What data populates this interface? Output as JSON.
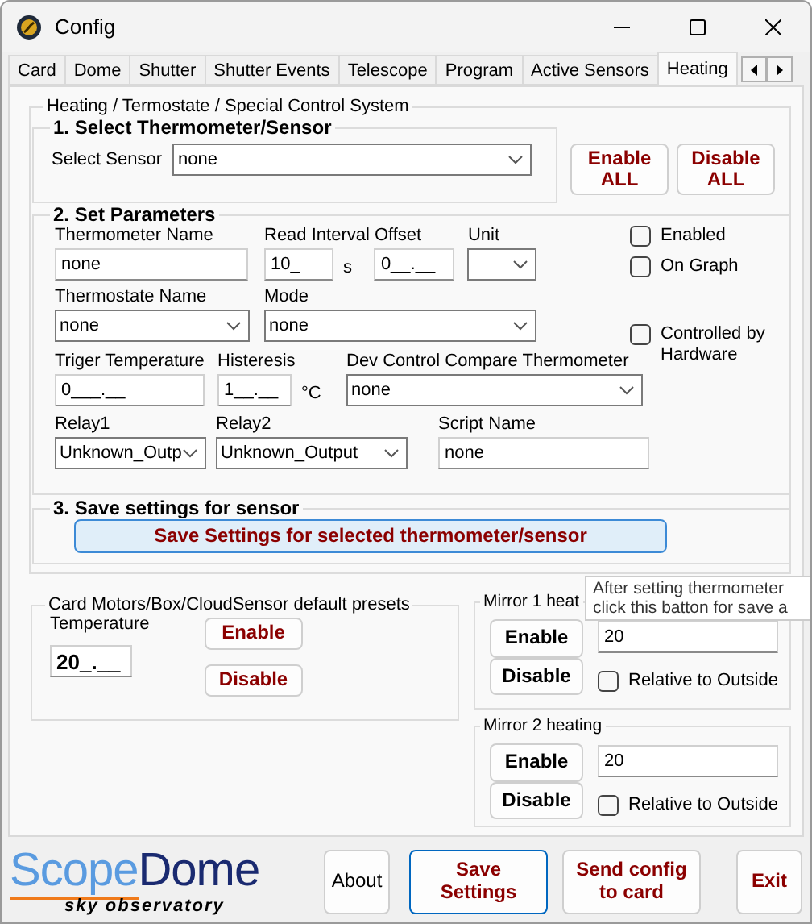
{
  "window": {
    "title": "Config"
  },
  "tabs": [
    {
      "label": "Card",
      "selected": false
    },
    {
      "label": "Dome",
      "selected": false
    },
    {
      "label": "Shutter",
      "selected": false
    },
    {
      "label": "Shutter Events",
      "selected": false
    },
    {
      "label": "Telescope",
      "selected": false
    },
    {
      "label": "Program",
      "selected": false
    },
    {
      "label": "Active Sensors",
      "selected": false
    },
    {
      "label": "Heating",
      "selected": true
    }
  ],
  "heating": {
    "title": "Heating / Termostate / Special Control System",
    "select_sensor": {
      "title": "1. Select Thermometer/Sensor",
      "label": "Select Sensor",
      "value": "none"
    },
    "bulk_buttons": [
      "Enable ALL",
      "Disable ALL"
    ],
    "parameters": {
      "title": "2. Set Parameters",
      "rows": [
        [
          {
            "label": "Thermometer Name",
            "kind": "input",
            "value": "none"
          },
          {
            "label": "Read Interval",
            "kind": "input",
            "value": "10_",
            "suffix": "s"
          },
          {
            "label": "Offset",
            "kind": "input",
            "value": "0__.__"
          },
          {
            "label": "Unit",
            "kind": "select"
          }
        ],
        [
          {
            "label": "Thermostate Name",
            "kind": "select",
            "value": "none"
          },
          {
            "label": "Mode",
            "kind": "select",
            "value": "none"
          }
        ],
        [
          {
            "label": "Triger Temperature",
            "kind": "input",
            "value": "0___.__"
          },
          {
            "label": "Histeresis",
            "kind": "input",
            "value": "1__.__",
            "suffix": "°C"
          },
          {
            "label": "Dev Control Compare Thermometer",
            "kind": "select",
            "value": "none"
          }
        ],
        [
          {
            "label": "Relay1",
            "kind": "select",
            "value": "Unknown_Outp"
          },
          {
            "label": "Relay2",
            "kind": "select",
            "value": "Unknown_Output"
          },
          {
            "label": "Script Name",
            "kind": "input",
            "value": "none"
          }
        ]
      ],
      "checkboxes": [
        {
          "label": "Enabled",
          "checked": false
        },
        {
          "label": "On Graph",
          "checked": false
        },
        {
          "label": "Controlled by Hardware",
          "checked": false
        }
      ]
    },
    "save": {
      "title": "3. Save settings for sensor",
      "button": "Save Settings for selected thermometer/sensor"
    }
  },
  "presets": {
    "title": "Card Motors/Box/CloudSensor default presets",
    "temperature_label": "Temperature",
    "temperature_value": "20_.__",
    "buttons": [
      "Enable",
      "Disable"
    ]
  },
  "mirrors": [
    {
      "title": "Mirror 1 heat",
      "buttons": [
        "Enable",
        "Disable"
      ],
      "value": "20",
      "relative": {
        "label": "Relative to Outside",
        "checked": false
      }
    },
    {
      "title": "Mirror 2 heating",
      "buttons": [
        "Enable",
        "Disable"
      ],
      "value": "20",
      "relative": {
        "label": "Relative to Outside",
        "checked": false
      }
    }
  ],
  "tooltip": {
    "lines": [
      "After setting thermometer",
      "click this batton for save a"
    ]
  },
  "logo": {
    "part_1": "Scope",
    "part_2": "Dome",
    "tagline": "sky observatory"
  },
  "footer_buttons": [
    {
      "label": "About",
      "kind": "plain"
    },
    {
      "label": "Save Settings",
      "kind": "default"
    },
    {
      "label": "Send config to card",
      "kind": "action"
    },
    {
      "label": "Exit",
      "kind": "action"
    }
  ]
}
